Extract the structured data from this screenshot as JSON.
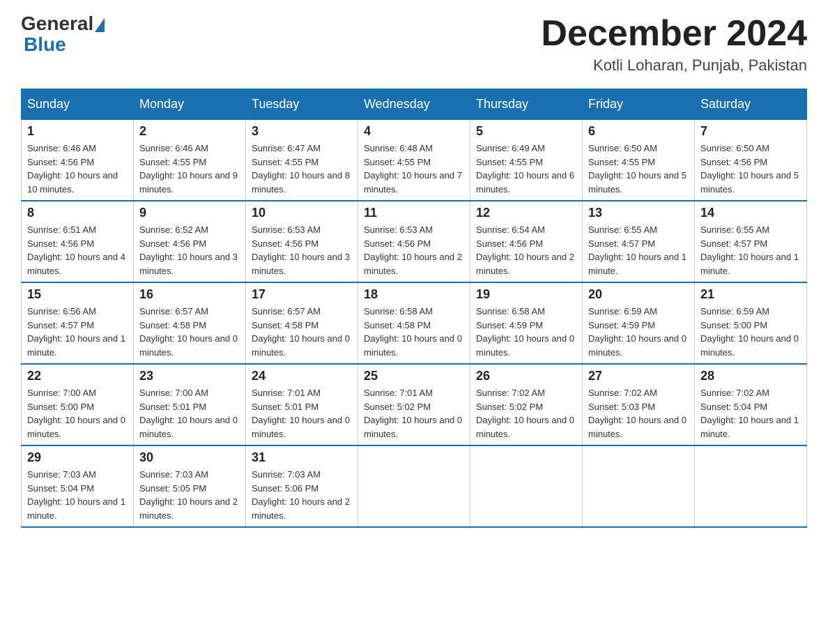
{
  "logo": {
    "general": "General",
    "blue": "Blue",
    "triangle_char": "▲"
  },
  "title": "December 2024",
  "location": "Kotli Loharan, Punjab, Pakistan",
  "days_of_week": [
    "Sunday",
    "Monday",
    "Tuesday",
    "Wednesday",
    "Thursday",
    "Friday",
    "Saturday"
  ],
  "weeks": [
    [
      {
        "day": "1",
        "sunrise": "6:46 AM",
        "sunset": "4:56 PM",
        "daylight": "10 hours and 10 minutes."
      },
      {
        "day": "2",
        "sunrise": "6:46 AM",
        "sunset": "4:55 PM",
        "daylight": "10 hours and 9 minutes."
      },
      {
        "day": "3",
        "sunrise": "6:47 AM",
        "sunset": "4:55 PM",
        "daylight": "10 hours and 8 minutes."
      },
      {
        "day": "4",
        "sunrise": "6:48 AM",
        "sunset": "4:55 PM",
        "daylight": "10 hours and 7 minutes."
      },
      {
        "day": "5",
        "sunrise": "6:49 AM",
        "sunset": "4:55 PM",
        "daylight": "10 hours and 6 minutes."
      },
      {
        "day": "6",
        "sunrise": "6:50 AM",
        "sunset": "4:55 PM",
        "daylight": "10 hours and 5 minutes."
      },
      {
        "day": "7",
        "sunrise": "6:50 AM",
        "sunset": "4:56 PM",
        "daylight": "10 hours and 5 minutes."
      }
    ],
    [
      {
        "day": "8",
        "sunrise": "6:51 AM",
        "sunset": "4:56 PM",
        "daylight": "10 hours and 4 minutes."
      },
      {
        "day": "9",
        "sunrise": "6:52 AM",
        "sunset": "4:56 PM",
        "daylight": "10 hours and 3 minutes."
      },
      {
        "day": "10",
        "sunrise": "6:53 AM",
        "sunset": "4:56 PM",
        "daylight": "10 hours and 3 minutes."
      },
      {
        "day": "11",
        "sunrise": "6:53 AM",
        "sunset": "4:56 PM",
        "daylight": "10 hours and 2 minutes."
      },
      {
        "day": "12",
        "sunrise": "6:54 AM",
        "sunset": "4:56 PM",
        "daylight": "10 hours and 2 minutes."
      },
      {
        "day": "13",
        "sunrise": "6:55 AM",
        "sunset": "4:57 PM",
        "daylight": "10 hours and 1 minute."
      },
      {
        "day": "14",
        "sunrise": "6:55 AM",
        "sunset": "4:57 PM",
        "daylight": "10 hours and 1 minute."
      }
    ],
    [
      {
        "day": "15",
        "sunrise": "6:56 AM",
        "sunset": "4:57 PM",
        "daylight": "10 hours and 1 minute."
      },
      {
        "day": "16",
        "sunrise": "6:57 AM",
        "sunset": "4:58 PM",
        "daylight": "10 hours and 0 minutes."
      },
      {
        "day": "17",
        "sunrise": "6:57 AM",
        "sunset": "4:58 PM",
        "daylight": "10 hours and 0 minutes."
      },
      {
        "day": "18",
        "sunrise": "6:58 AM",
        "sunset": "4:58 PM",
        "daylight": "10 hours and 0 minutes."
      },
      {
        "day": "19",
        "sunrise": "6:58 AM",
        "sunset": "4:59 PM",
        "daylight": "10 hours and 0 minutes."
      },
      {
        "day": "20",
        "sunrise": "6:59 AM",
        "sunset": "4:59 PM",
        "daylight": "10 hours and 0 minutes."
      },
      {
        "day": "21",
        "sunrise": "6:59 AM",
        "sunset": "5:00 PM",
        "daylight": "10 hours and 0 minutes."
      }
    ],
    [
      {
        "day": "22",
        "sunrise": "7:00 AM",
        "sunset": "5:00 PM",
        "daylight": "10 hours and 0 minutes."
      },
      {
        "day": "23",
        "sunrise": "7:00 AM",
        "sunset": "5:01 PM",
        "daylight": "10 hours and 0 minutes."
      },
      {
        "day": "24",
        "sunrise": "7:01 AM",
        "sunset": "5:01 PM",
        "daylight": "10 hours and 0 minutes."
      },
      {
        "day": "25",
        "sunrise": "7:01 AM",
        "sunset": "5:02 PM",
        "daylight": "10 hours and 0 minutes."
      },
      {
        "day": "26",
        "sunrise": "7:02 AM",
        "sunset": "5:02 PM",
        "daylight": "10 hours and 0 minutes."
      },
      {
        "day": "27",
        "sunrise": "7:02 AM",
        "sunset": "5:03 PM",
        "daylight": "10 hours and 0 minutes."
      },
      {
        "day": "28",
        "sunrise": "7:02 AM",
        "sunset": "5:04 PM",
        "daylight": "10 hours and 1 minute."
      }
    ],
    [
      {
        "day": "29",
        "sunrise": "7:03 AM",
        "sunset": "5:04 PM",
        "daylight": "10 hours and 1 minute."
      },
      {
        "day": "30",
        "sunrise": "7:03 AM",
        "sunset": "5:05 PM",
        "daylight": "10 hours and 2 minutes."
      },
      {
        "day": "31",
        "sunrise": "7:03 AM",
        "sunset": "5:06 PM",
        "daylight": "10 hours and 2 minutes."
      },
      null,
      null,
      null,
      null
    ]
  ]
}
